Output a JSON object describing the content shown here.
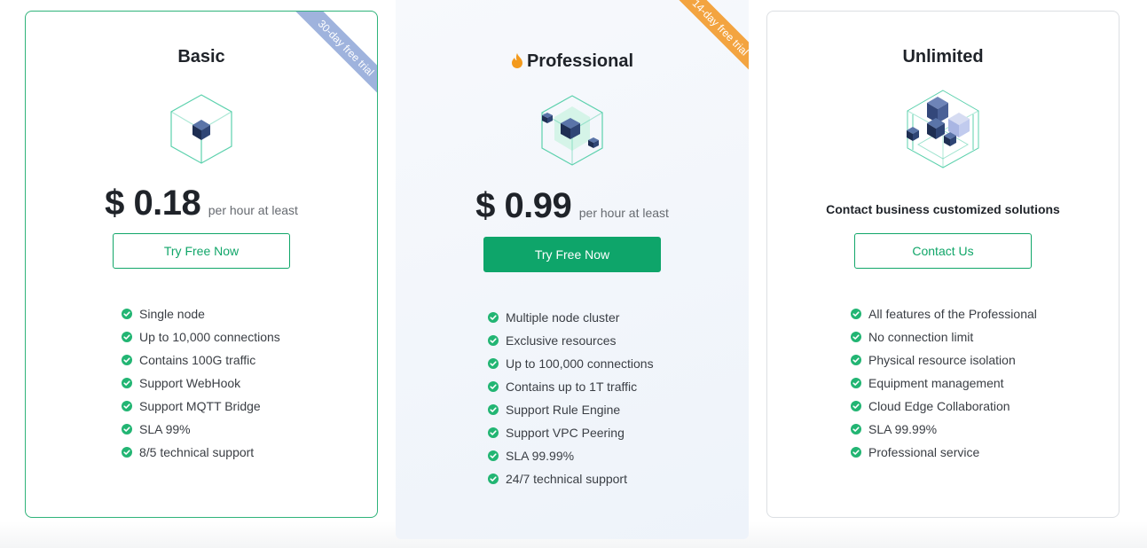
{
  "plans": [
    {
      "title": "Basic",
      "ribbon": "30-day free trial",
      "price": "$ 0.18",
      "price_unit": "per hour at least",
      "button": "Try Free Now",
      "features": [
        "Single node",
        "Up to 10,000 connections",
        "Contains 100G traffic",
        "Support WebHook",
        "Support MQTT Bridge",
        "SLA 99%",
        "8/5 technical support"
      ]
    },
    {
      "title": "Professional",
      "title_icon": "flame-icon",
      "ribbon": "14-day free trial",
      "price": "$ 0.99",
      "price_unit": "per hour at least",
      "button": "Try Free Now",
      "features": [
        "Multiple node cluster",
        "Exclusive resources",
        "Up to 100,000 connections",
        "Contains up to 1T traffic",
        "Support Rule Engine",
        "Support VPC Peering",
        "SLA 99.99%",
        "24/7 technical support"
      ]
    },
    {
      "title": "Unlimited",
      "contact_text": "Contact business customized solutions",
      "button": "Contact Us",
      "features": [
        "All features of the Professional",
        "No connection limit",
        "Physical resource isolation",
        "Equipment management",
        "Cloud Edge Collaboration",
        "SLA 99.99%",
        "Professional service"
      ]
    }
  ],
  "colors": {
    "accent": "#0ea56a",
    "check": "#22b573",
    "ribbon_basic": "#9fb3dd",
    "ribbon_pro": "#f3a440",
    "flame": "#f39a1d"
  },
  "icons": {
    "feature_bullet": "check-circle-icon",
    "basic_illustration": "cube-single-icon",
    "pro_illustration": "cube-cluster-icon",
    "unlimited_illustration": "cube-stack-icon"
  }
}
